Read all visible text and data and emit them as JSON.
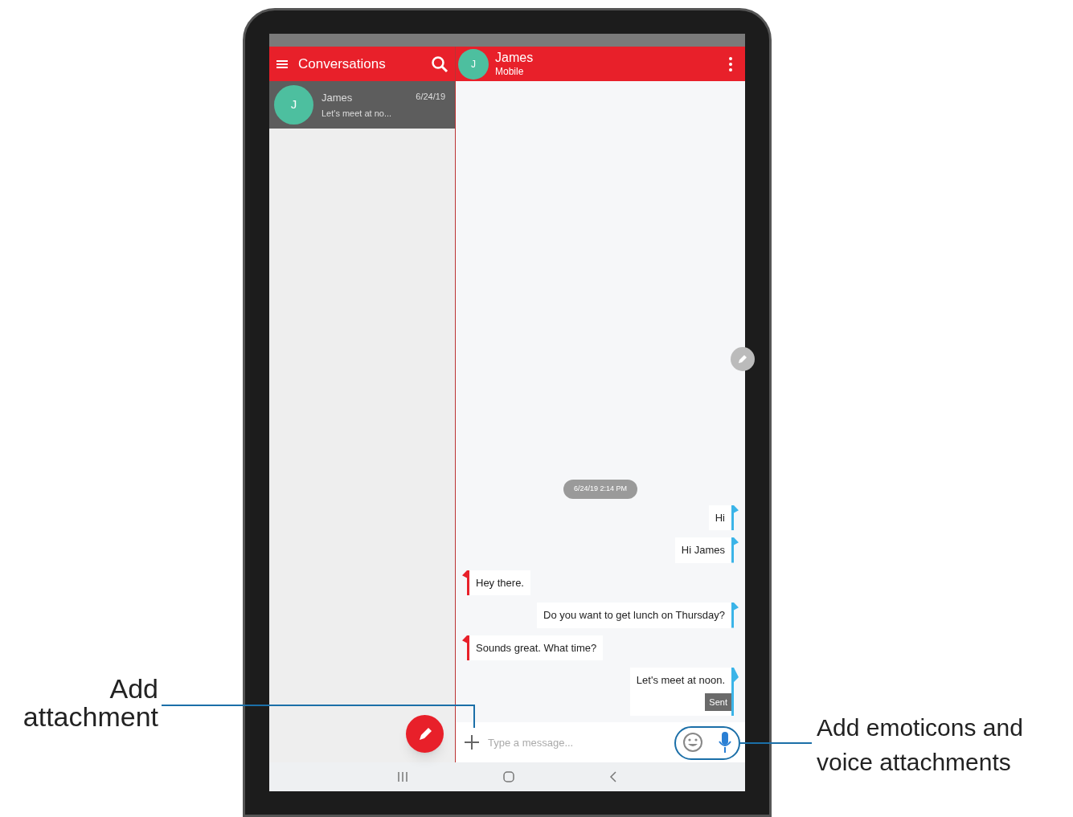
{
  "conversations_pane": {
    "title": "Conversations",
    "items": [
      {
        "initial": "J",
        "name": "James",
        "date": "6/24/19",
        "preview": "Let's meet at no...",
        "selected": true
      }
    ]
  },
  "chat_pane": {
    "contact": {
      "initial": "J",
      "name": "James",
      "subtitle": "Mobile"
    },
    "timestamp": "6/24/19 2:14 PM",
    "messages": [
      {
        "kind": "outgoing",
        "text": "Hi"
      },
      {
        "kind": "outgoing",
        "text": "Hi James"
      },
      {
        "kind": "incoming",
        "text": "Hey there."
      },
      {
        "kind": "outgoing",
        "text": "Do you want to get lunch on Thursday?"
      },
      {
        "kind": "incoming",
        "text": "Sounds great. What time?"
      },
      {
        "kind": "outgoing",
        "text": "Let's meet at noon.",
        "status": "Sent"
      }
    ],
    "composer": {
      "placeholder": "Type a message..."
    }
  },
  "callouts": [
    {
      "text": "Add attachment"
    },
    {
      "text": "Add emoticons and voice attachments"
    }
  ]
}
